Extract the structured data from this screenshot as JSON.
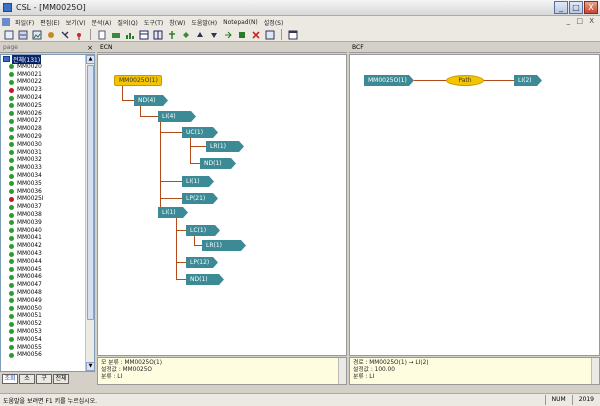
{
  "window": {
    "title": "CSL - [MM0025O]",
    "controls": [
      "_",
      "□",
      "X"
    ]
  },
  "menu": [
    "파일(F)",
    "편집(E)",
    "보기(V)",
    "분석(A)",
    "질의(Q)",
    "도구(T)",
    "창(W)",
    "도움말(H)",
    "Notepad(N)",
    "설정(S)"
  ],
  "mdi_controls": "_ □ X",
  "toolbar": {
    "icons": [
      "new-icon",
      "open-icon",
      "image-icon",
      "tools-icon",
      "help-icon",
      "sep",
      "doc-icon",
      "print-icon",
      "zoom-icon",
      "table-icon",
      "chart-icon",
      "tree-icon",
      "link-icon",
      "flag-icon",
      "up-icon",
      "down-icon",
      "delete-icon",
      "list-icon",
      "sep",
      "grid-icon"
    ]
  },
  "left_panel": {
    "header": "page",
    "root": "전체(131)",
    "items": [
      {
        "label": "MM0020",
        "status": "#2e9b2e"
      },
      {
        "label": "MM0021",
        "status": "#2e9b2e"
      },
      {
        "label": "MM0022",
        "status": "#2e9b2e"
      },
      {
        "label": "MM0023",
        "status": "#c0182a"
      },
      {
        "label": "MM0024",
        "status": "#2e9b2e"
      },
      {
        "label": "MM0025",
        "status": "#2e9b2e"
      },
      {
        "label": "MM0026",
        "status": "#2e9b2e"
      },
      {
        "label": "MM0027",
        "status": "#2e9b2e"
      },
      {
        "label": "MM0028",
        "status": "#2e9b2e"
      },
      {
        "label": "MM0029",
        "status": "#2e9b2e"
      },
      {
        "label": "MM0030",
        "status": "#2e9b2e"
      },
      {
        "label": "MM0031",
        "status": "#2e9b2e"
      },
      {
        "label": "MM0032",
        "status": "#2e9b2e"
      },
      {
        "label": "MM0033",
        "status": "#2e9b2e"
      },
      {
        "label": "MM0034",
        "status": "#2e9b2e"
      },
      {
        "label": "MM0035",
        "status": "#2e9b2e"
      },
      {
        "label": "MM0036",
        "status": "#2e9b2e"
      },
      {
        "label": "MM0025I",
        "status": "#c0182a"
      },
      {
        "label": "MM0037",
        "status": "#2e9b2e"
      },
      {
        "label": "MM0038",
        "status": "#2e9b2e"
      },
      {
        "label": "MM0039",
        "status": "#2e9b2e"
      },
      {
        "label": "MM0040",
        "status": "#2e9b2e"
      },
      {
        "label": "MM0041",
        "status": "#2e9b2e"
      },
      {
        "label": "MM0042",
        "status": "#2e9b2e"
      },
      {
        "label": "MM0043",
        "status": "#2e9b2e"
      },
      {
        "label": "MM0044",
        "status": "#2e9b2e"
      },
      {
        "label": "MM0045",
        "status": "#2e9b2e"
      },
      {
        "label": "MM0046",
        "status": "#2e9b2e"
      },
      {
        "label": "MM0047",
        "status": "#2e9b2e"
      },
      {
        "label": "MM0048",
        "status": "#2e9b2e"
      },
      {
        "label": "MM0049",
        "status": "#2e9b2e"
      },
      {
        "label": "MM0050",
        "status": "#2e9b2e"
      },
      {
        "label": "MM0051",
        "status": "#2e9b2e"
      },
      {
        "label": "MM0052",
        "status": "#2e9b2e"
      },
      {
        "label": "MM0053",
        "status": "#2e9b2e"
      },
      {
        "label": "MM0054",
        "status": "#2e9b2e"
      },
      {
        "label": "MM0055",
        "status": "#2e9b2e"
      },
      {
        "label": "MM0056",
        "status": "#2e9b2e"
      }
    ],
    "tabs": [
      "조회",
      "소",
      "구",
      "전체"
    ]
  },
  "ecn": {
    "header": "ECN",
    "nodes": [
      "MM0025O(1)",
      "ND(4)",
      "LI(4)",
      "UC(1)",
      "LR(1)",
      "ND(1)",
      "LI(1)",
      "LP(21)",
      "LI(1)",
      "LC(1)",
      "LR(1)",
      "LP(12)",
      "ND(1)"
    ],
    "info": [
      "모 분류 : MM0025O(1)",
      "설정값 : MM0025O",
      "분류 : LI"
    ]
  },
  "bcf": {
    "header": "BCF",
    "nodes": [
      "MM0025O(1)",
      "Path",
      "LI(2)"
    ],
    "info": [
      "경로 : MM0025O(1) → LI(2)",
      "설정값 : 100.00",
      "분류 : LI"
    ]
  },
  "status": {
    "text": "도움말을 보려면 F1 키를 누르십시오.",
    "num": "NUM",
    "pos": "2019"
  }
}
